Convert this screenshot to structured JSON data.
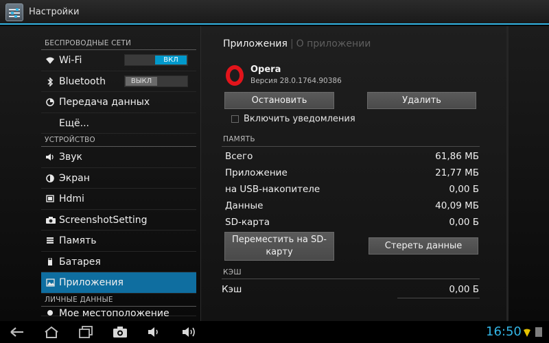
{
  "window": {
    "title": "Настройки"
  },
  "sidebar": {
    "sections": [
      {
        "header": "БЕСПРОВОДНЫЕ СЕТИ"
      },
      {
        "header": "УСТРОЙСТВО"
      },
      {
        "header": "ЛИЧНЫЕ ДАННЫЕ"
      }
    ],
    "items": [
      {
        "label": "Wi-Fi",
        "icon": "wifi-icon",
        "toggle": "ВКЛ"
      },
      {
        "label": "Bluetooth",
        "icon": "bluetooth-icon",
        "toggle": "ВЫКЛ"
      },
      {
        "label": "Передача данных",
        "icon": "data-usage-icon"
      },
      {
        "label": "Ещё..."
      },
      {
        "label": "Звук",
        "icon": "volume-icon"
      },
      {
        "label": "Экран",
        "icon": "brightness-icon"
      },
      {
        "label": "Hdmi",
        "icon": "hdmi-icon"
      },
      {
        "label": "ScreenshotSetting",
        "icon": "camera-icon"
      },
      {
        "label": "Память",
        "icon": "storage-icon"
      },
      {
        "label": "Батарея",
        "icon": "battery-icon"
      },
      {
        "label": "Приложения",
        "icon": "apps-icon",
        "active": true
      },
      {
        "label": "Мое местоположение",
        "icon": "location-icon"
      }
    ]
  },
  "detail": {
    "breadcrumb": {
      "current": "Приложения",
      "other": "О приложении"
    },
    "app": {
      "name": "Opera",
      "version": "Версия 28.0.1764.90386"
    },
    "buttons": {
      "stop": "Остановить",
      "uninstall": "Удалить",
      "move_to_sd": "Переместить на SD-карту",
      "clear_data": "Стереть данные"
    },
    "notifications_label": "Включить уведомления",
    "memory": {
      "header": "ПАМЯТЬ",
      "rows": [
        {
          "label": "Всего",
          "value": "61,86 МБ"
        },
        {
          "label": "Приложение",
          "value": "21,77 МБ"
        },
        {
          "label": "на USB-накопителе",
          "value": "0,00 Б"
        },
        {
          "label": "Данные",
          "value": "40,09 МБ"
        },
        {
          "label": "SD-карта",
          "value": "0,00 Б"
        }
      ]
    },
    "cache": {
      "header": "КЭШ",
      "rows": [
        {
          "label": "Кэш",
          "value": "0,00 Б"
        }
      ]
    }
  },
  "statusbar": {
    "time": "16:50"
  },
  "colors": {
    "accent": "#33b5e5",
    "selected": "#0f6ea0",
    "opera_red": "#e2141b"
  }
}
